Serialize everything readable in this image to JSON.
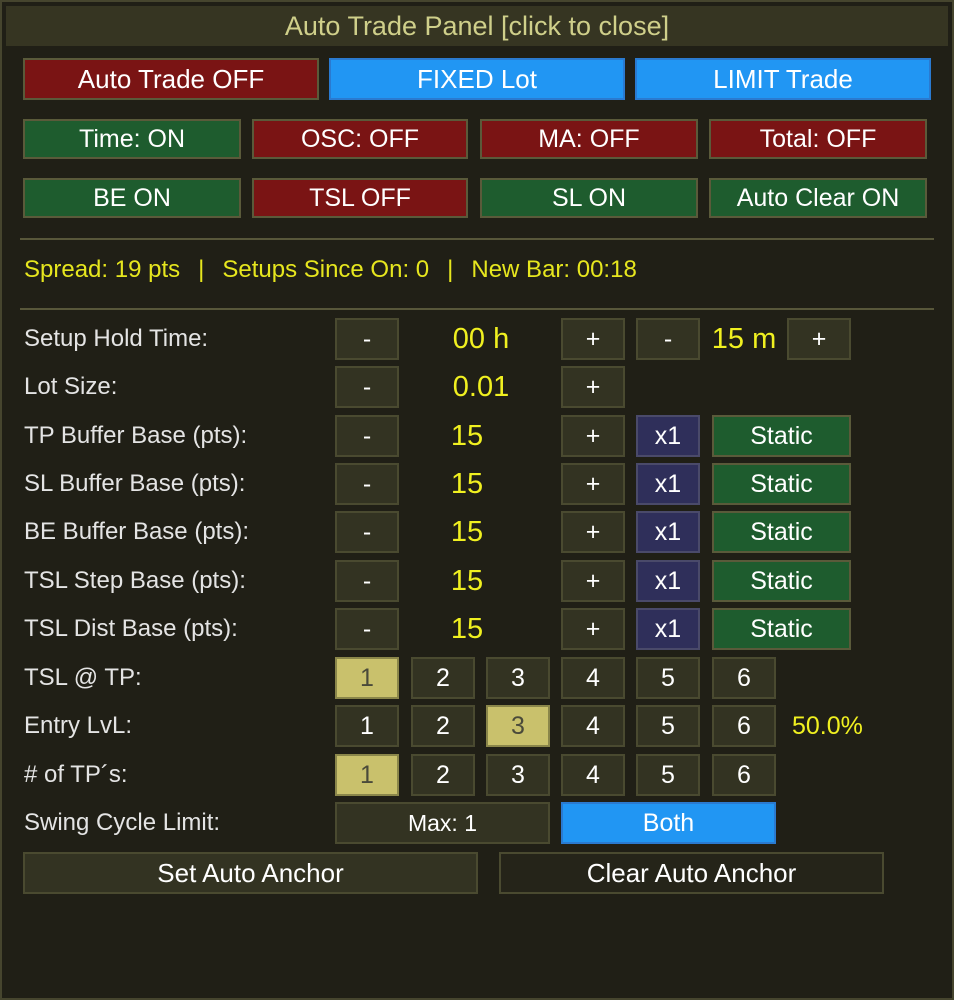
{
  "title": "Auto Trade Panel  [click to close]",
  "top_buttons": {
    "auto_trade": "Auto Trade OFF",
    "lot_mode": "FIXED Lot",
    "trade_type": "LIMIT Trade"
  },
  "toggles_row1": {
    "time": "Time: ON",
    "osc": "OSC: OFF",
    "ma": "MA: OFF",
    "total": "Total: OFF"
  },
  "toggles_row2": {
    "be": "BE ON",
    "tsl": "TSL OFF",
    "sl": "SL ON",
    "auto_clear": "Auto Clear ON"
  },
  "status": {
    "spread": "Spread: 19 pts",
    "separator": "|",
    "setups": "Setups Since On: 0",
    "new_bar": "New Bar: 00:18"
  },
  "controls": {
    "minus": "-",
    "plus": "+",
    "setup_hold": {
      "label": "Setup Hold Time:",
      "hours": "00 h",
      "minutes": "15 m"
    },
    "lot_size": {
      "label": "Lot Size:",
      "value": "0.01"
    },
    "tp_buffer": {
      "label": "TP Buffer Base (pts):",
      "value": "15",
      "mult": "x1",
      "mode": "Static"
    },
    "sl_buffer": {
      "label": "SL Buffer Base (pts):",
      "value": "15",
      "mult": "x1",
      "mode": "Static"
    },
    "be_buffer": {
      "label": "BE Buffer Base (pts):",
      "value": "15",
      "mult": "x1",
      "mode": "Static"
    },
    "tsl_step": {
      "label": "TSL Step Base (pts):",
      "value": "15",
      "mult": "x1",
      "mode": "Static"
    },
    "tsl_dist": {
      "label": "TSL Dist Base (pts):",
      "value": "15",
      "mult": "x1",
      "mode": "Static"
    }
  },
  "selectors": {
    "numbers": [
      "1",
      "2",
      "3",
      "4",
      "5",
      "6"
    ],
    "tsl_at_tp": {
      "label": "TSL @ TP:",
      "selected": "1"
    },
    "entry_lvl": {
      "label": "Entry LvL:",
      "selected": "3",
      "percent": "50.0%"
    },
    "num_tps": {
      "label": "# of TP´s:",
      "selected": "1"
    }
  },
  "swing": {
    "label": "Swing Cycle Limit:",
    "max": "Max: 1",
    "mode": "Both"
  },
  "anchor": {
    "set": "Set Auto Anchor",
    "clear": "Clear Auto Anchor"
  },
  "colors": {
    "off_red": "#7a1414",
    "on_green": "#1e5c2e",
    "active_blue": "#2196f3",
    "value_yellow": "#f0f020",
    "selected_yellow": "#c9c16c"
  }
}
